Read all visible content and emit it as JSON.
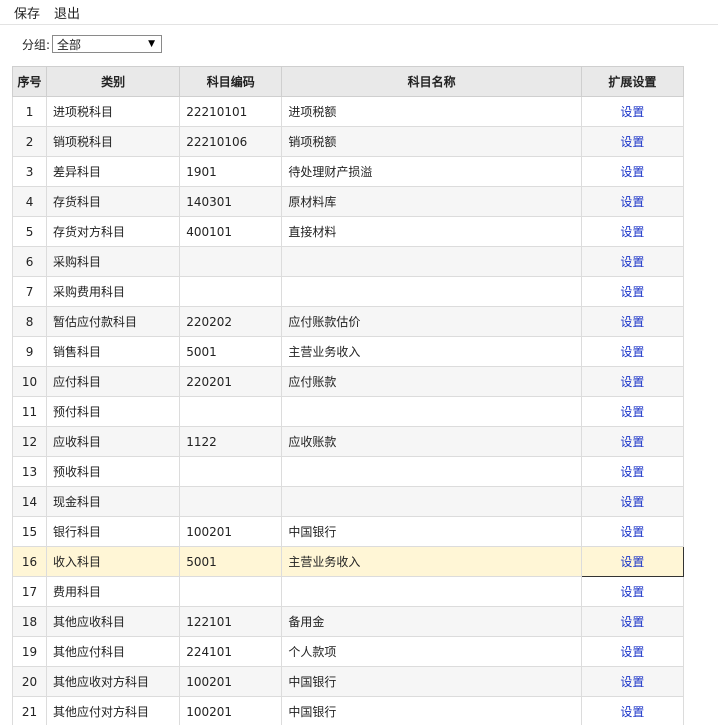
{
  "toolbar": {
    "save_label": "保存",
    "exit_label": "退出"
  },
  "filter": {
    "label": "分组:",
    "selected": "全部"
  },
  "table": {
    "headers": [
      "序号",
      "类别",
      "科目编码",
      "科目名称",
      "扩展设置"
    ],
    "action_label": "设置",
    "selected_row": 16,
    "rows": [
      {
        "no": "1",
        "category": "进项税科目",
        "code": "22210101",
        "name": "进项税额"
      },
      {
        "no": "2",
        "category": "销项税科目",
        "code": "22210106",
        "name": "销项税额"
      },
      {
        "no": "3",
        "category": "差异科目",
        "code": "1901",
        "name": "待处理财产损溢"
      },
      {
        "no": "4",
        "category": "存货科目",
        "code": "140301",
        "name": "原材料库"
      },
      {
        "no": "5",
        "category": "存货对方科目",
        "code": "400101",
        "name": "直接材料"
      },
      {
        "no": "6",
        "category": "采购科目",
        "code": "",
        "name": ""
      },
      {
        "no": "7",
        "category": "采购费用科目",
        "code": "",
        "name": ""
      },
      {
        "no": "8",
        "category": "暂估应付款科目",
        "code": "220202",
        "name": "应付账款估价"
      },
      {
        "no": "9",
        "category": "销售科目",
        "code": "5001",
        "name": "主营业务收入"
      },
      {
        "no": "10",
        "category": "应付科目",
        "code": "220201",
        "name": "应付账款"
      },
      {
        "no": "11",
        "category": "预付科目",
        "code": "",
        "name": ""
      },
      {
        "no": "12",
        "category": "应收科目",
        "code": "1122",
        "name": "应收账款"
      },
      {
        "no": "13",
        "category": "预收科目",
        "code": "",
        "name": ""
      },
      {
        "no": "14",
        "category": "现金科目",
        "code": "",
        "name": ""
      },
      {
        "no": "15",
        "category": "银行科目",
        "code": "100201",
        "name": "中国银行"
      },
      {
        "no": "16",
        "category": "收入科目",
        "code": "5001",
        "name": "主营业务收入"
      },
      {
        "no": "17",
        "category": "费用科目",
        "code": "",
        "name": ""
      },
      {
        "no": "18",
        "category": "其他应收科目",
        "code": "122101",
        "name": "备用金"
      },
      {
        "no": "19",
        "category": "其他应付科目",
        "code": "224101",
        "name": "个人款项"
      },
      {
        "no": "20",
        "category": "其他应收对方科目",
        "code": "100201",
        "name": "中国银行"
      },
      {
        "no": "21",
        "category": "其他应付对方科目",
        "code": "100201",
        "name": "中国银行"
      }
    ]
  },
  "colors": {
    "link": "#1a33c8",
    "selected_row_bg": "#fff6d6",
    "header_bg": "#e9e9e9"
  }
}
